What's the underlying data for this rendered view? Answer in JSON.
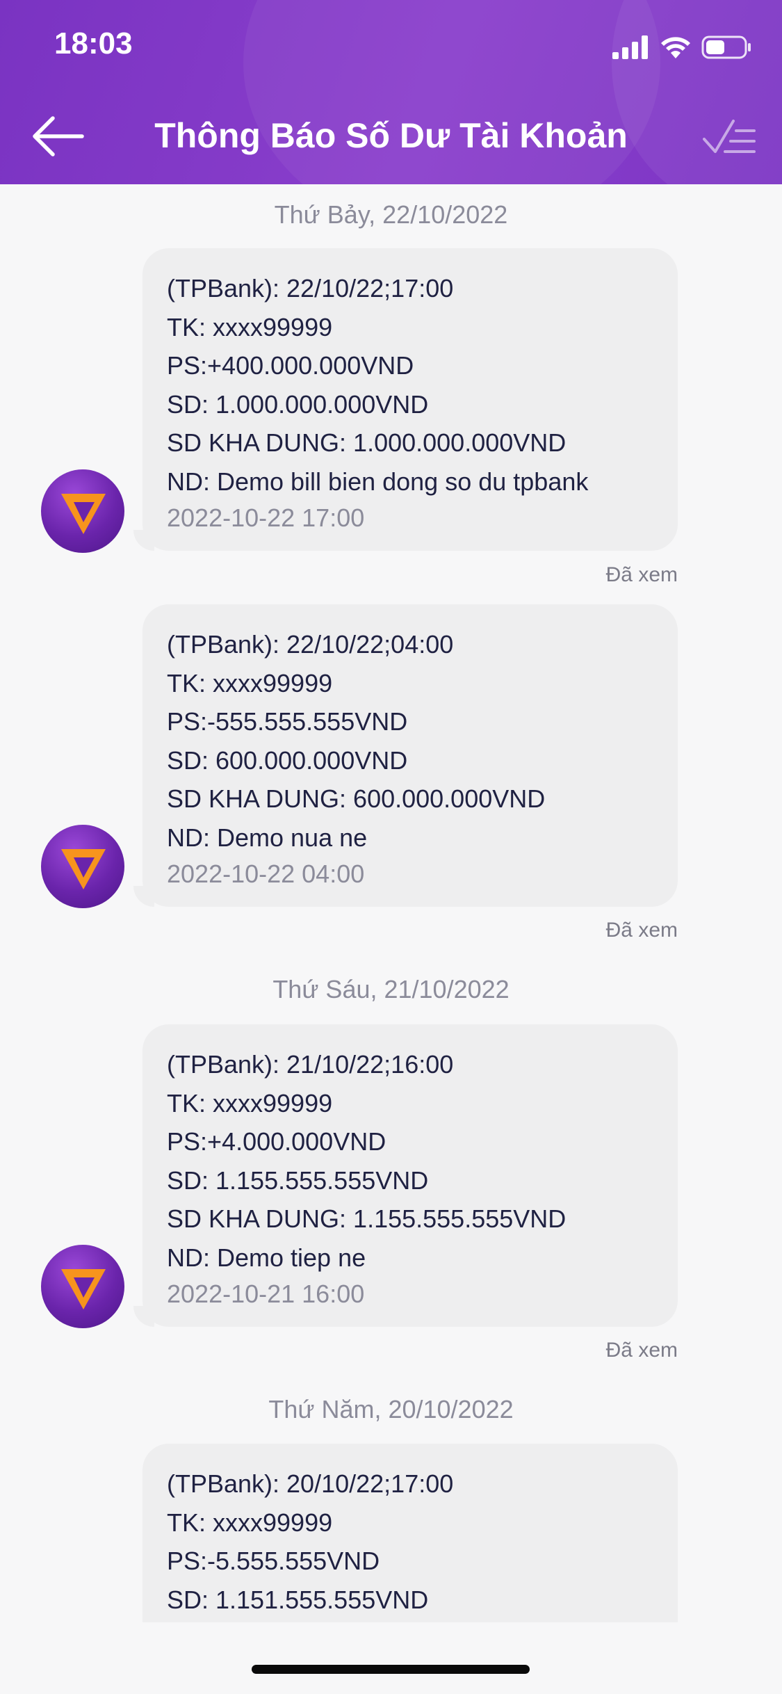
{
  "status_bar": {
    "time": "18:03"
  },
  "header": {
    "title": "Thông Báo Số Dư Tài Khoản"
  },
  "groups": [
    {
      "date": "Thứ Bảy, 22/10/2022"
    },
    {
      "date": "Thứ Sáu, 21/10/2022"
    },
    {
      "date": "Thứ Năm, 20/10/2022"
    }
  ],
  "messages": [
    {
      "lines": [
        "(TPBank): 22/10/22;17:00",
        "TK: xxxx99999",
        "PS:+400.000.000VND",
        "SD: 1.000.000.000VND",
        "SD KHA DUNG: 1.000.000.000VND",
        "ND: Demo bill bien dong so du tpbank"
      ],
      "time": "2022-10-22 17:00",
      "status": "Đã xem"
    },
    {
      "lines": [
        "(TPBank): 22/10/22;04:00",
        "TK: xxxx99999",
        "PS:-555.555.555VND",
        "SD: 600.000.000VND",
        "SD KHA DUNG: 600.000.000VND",
        "ND: Demo nua ne"
      ],
      "time": "2022-10-22 04:00",
      "status": "Đã xem"
    },
    {
      "lines": [
        "(TPBank): 21/10/22;16:00",
        "TK: xxxx99999",
        "PS:+4.000.000VND",
        "SD: 1.155.555.555VND",
        "SD KHA DUNG: 1.155.555.555VND",
        "ND: Demo tiep ne"
      ],
      "time": "2022-10-21 16:00",
      "status": "Đã xem"
    },
    {
      "lines": [
        "(TPBank): 20/10/22;17:00",
        "TK: xxxx99999",
        "PS:-5.555.555VND",
        "SD: 1.151.555.555VND"
      ]
    }
  ],
  "colors": {
    "header": "#8a3fcc",
    "bubble": "#eeeeef",
    "text": "#1f2142",
    "muted": "#8b8b9a",
    "logo_orange": "#f7941d"
  }
}
